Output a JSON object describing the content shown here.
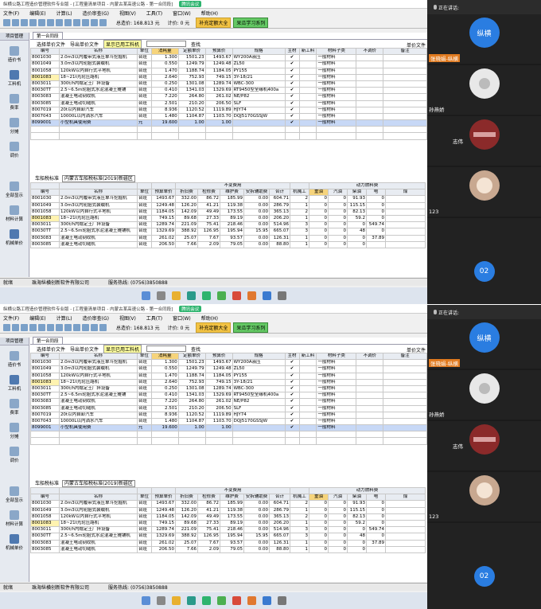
{
  "title": "纵横公路工程造价管理软件专业版 - [工程量清单项目 - 内蒙古某高速公路 - 第一合同段]",
  "meeting_badge": "腾讯会议",
  "menu": [
    "文件(F)",
    "编辑(E)",
    "计算(L)",
    "造价审查(G)",
    "视图(V)",
    "工具(T)",
    "窗口(W)",
    "帮助(H)"
  ],
  "toolbar": {
    "price_label": "总造价: 168.813 元",
    "unit_label": "计价: 0 元",
    "btn_quota": "补充定额大全",
    "btn_learn": "呆瓜学习系列"
  },
  "tabs": {
    "project_mgmt": "项目管理",
    "segment": "第一合同段"
  },
  "left_nav": [
    "造价书",
    "工料机",
    "费率",
    "分摊",
    "调价"
  ],
  "left_bottom": [
    "全部显示",
    "材料计算",
    "机械单价"
  ],
  "sub": {
    "select_price": "选择单价文件",
    "export_price": "导出单价文件",
    "show_used": "显示已用工料机",
    "search_btn": "查找",
    "unit_price_file": "单价文件"
  },
  "top_table": {
    "headers": [
      "编号",
      "名称",
      "单位",
      "消耗量",
      "定额单价",
      "预算价",
      "规格",
      "主材",
      "新工料",
      "材料子类",
      "不调价",
      "备注"
    ],
    "rows": [
      [
        "8001030",
        "2.0m3以内履带式液压单斗挖掘机",
        "台班",
        "1.300",
        "1501.23",
        "1493.67",
        "WY200A液压",
        "✔",
        "",
        "一般材料",
        "",
        ""
      ],
      [
        "8001049",
        "3.0m3以内轮胎式装载机",
        "台班",
        "0.550",
        "1249.79",
        "1249.48",
        "ZL50",
        "✔",
        "",
        "一般材料",
        "",
        ""
      ],
      [
        "8001058",
        "120kW以内自行式平地机",
        "台班",
        "1.470",
        "1188.74",
        "1184.05",
        "PY155",
        "✔",
        "",
        "一般材料",
        "",
        ""
      ],
      [
        "8001083",
        "18~21t光轮压路机",
        "台班",
        "2.640",
        "752.93",
        "749.15",
        "3Y-18/21",
        "✔",
        "",
        "一般材料",
        "",
        ""
      ],
      [
        "8003011",
        "300t/h内稳定土厂拌设备",
        "台班",
        "0.250",
        "1301.08",
        "1289.74",
        "WBC-300",
        "✔",
        "",
        "一般材料",
        "",
        ""
      ],
      [
        "80030TT",
        "2.5~6.5m轮胎式水泥混凝土摊铺",
        "台班",
        "0.410",
        "1341.03",
        "1329.69",
        "RT9450型全缘机400a",
        "✔",
        "",
        "一般材料",
        "",
        ""
      ],
      [
        "8003083",
        "混凝土电动刻纹机",
        "台班",
        "7.220",
        "264.80",
        "261.02",
        "NE/P82",
        "✔",
        "",
        "一般材料",
        "",
        ""
      ],
      [
        "8003085",
        "混凝土电动切缝机",
        "台班",
        "2.501",
        "210.20",
        "206.50",
        "SLF",
        "✔",
        "",
        "一般材料",
        "",
        ""
      ],
      [
        "8007019",
        "20t以内自卸汽车",
        "台班",
        "8.936",
        "1120.52",
        "1119.89",
        "HJY74",
        "✔",
        "",
        "一般材料",
        "",
        ""
      ],
      [
        "8007043",
        "10000L以内洒水汽车",
        "台班",
        "1.480",
        "1104.87",
        "1103.70",
        "DQJ5170GSSJW",
        "✔",
        "",
        "一般材料",
        "",
        ""
      ],
      [
        "8099001",
        "小型机具使用费",
        "元",
        "19.600",
        "1.00",
        "1.00",
        "",
        "✔",
        "",
        "一般材料",
        "",
        ""
      ]
    ]
  },
  "bottom_label": "车船税标准",
  "bottom_value": "内蒙古车船税标准(2019)新疆区",
  "bottom_table": {
    "group_headers": {
      "fixed": "不变费用",
      "variable": "可变费",
      "power": "动力燃料费"
    },
    "headers": [
      "编号",
      "名称",
      "单位",
      "预算单价",
      "折旧费",
      "检修费",
      "维护费",
      "安拆辅助费",
      "合计",
      "机械工",
      "重油",
      "汽油",
      "柴油",
      "电",
      "煤"
    ],
    "rows": [
      [
        "8001030",
        "2.0m3以内履带式液压单斗挖掘机",
        "台班",
        "1493.67",
        "332.00",
        "86.72",
        "185.99",
        "0.00",
        "604.71",
        "2",
        "0",
        "0",
        "91.93",
        "0",
        ""
      ],
      [
        "8001049",
        "3.0m3以内轮胎式装载机",
        "台班",
        "1249.48",
        "126.20",
        "41.21",
        "119.38",
        "0.00",
        "286.79",
        "1",
        "0",
        "0",
        "115.15",
        "0",
        ""
      ],
      [
        "8001058",
        "120kW以内自行式平地机",
        "台班",
        "1184.05",
        "142.09",
        "49.49",
        "173.55",
        "0.00",
        "365.13",
        "2",
        "0",
        "0",
        "82.13",
        "0",
        ""
      ],
      [
        "8001083",
        "18~21t光轮压路机",
        "台班",
        "749.15",
        "89.68",
        "27.33",
        "89.19",
        "0.00",
        "206.20",
        "1",
        "0",
        "0",
        "59.2",
        "0",
        ""
      ],
      [
        "8003011",
        "300t/h内稳定土厂拌设备",
        "台班",
        "1289.74",
        "221.09",
        "75.41",
        "218.46",
        "0.00",
        "514.96",
        "3",
        "0",
        "0",
        "0",
        "549.74",
        ""
      ],
      [
        "80030TT",
        "2.5~6.5m轮胎式水泥混凝土摊铺机",
        "台班",
        "1329.69",
        "388.92",
        "126.95",
        "195.94",
        "15.95",
        "665.07",
        "3",
        "0",
        "0",
        "48",
        "0",
        ""
      ],
      [
        "8003083",
        "混凝土电动刻纹机",
        "台班",
        "261.02",
        "25.07",
        "7.67",
        "93.57",
        "0.00",
        "126.31",
        "1",
        "0",
        "0",
        "0",
        "37.89",
        ""
      ],
      [
        "8003085",
        "混凝土电动切缝机",
        "台班",
        "206.50",
        "7.66",
        "2.09",
        "79.05",
        "0.00",
        "88.80",
        "1",
        "0",
        "0",
        "0",
        "",
        ""
      ]
    ]
  },
  "status": {
    "left": "就绪",
    "company": "珠海纵横创新软件有限公司",
    "hotline": "服务热线: (0756)3850888"
  },
  "meeting": {
    "speaking_label": "正在讲话:",
    "participants": [
      {
        "name": "纵横",
        "label": "张晓娟-纵横",
        "color": "#2a7de1"
      },
      {
        "name": "",
        "label": "孙燕娇",
        "color": "#e8e8e8"
      },
      {
        "name": "",
        "label": "志伟",
        "color": "#8b2a2a"
      },
      {
        "name": "",
        "label": "123",
        "color": "#c8a890"
      },
      {
        "name": "02",
        "label": "",
        "color": "#2a7de1"
      }
    ]
  }
}
